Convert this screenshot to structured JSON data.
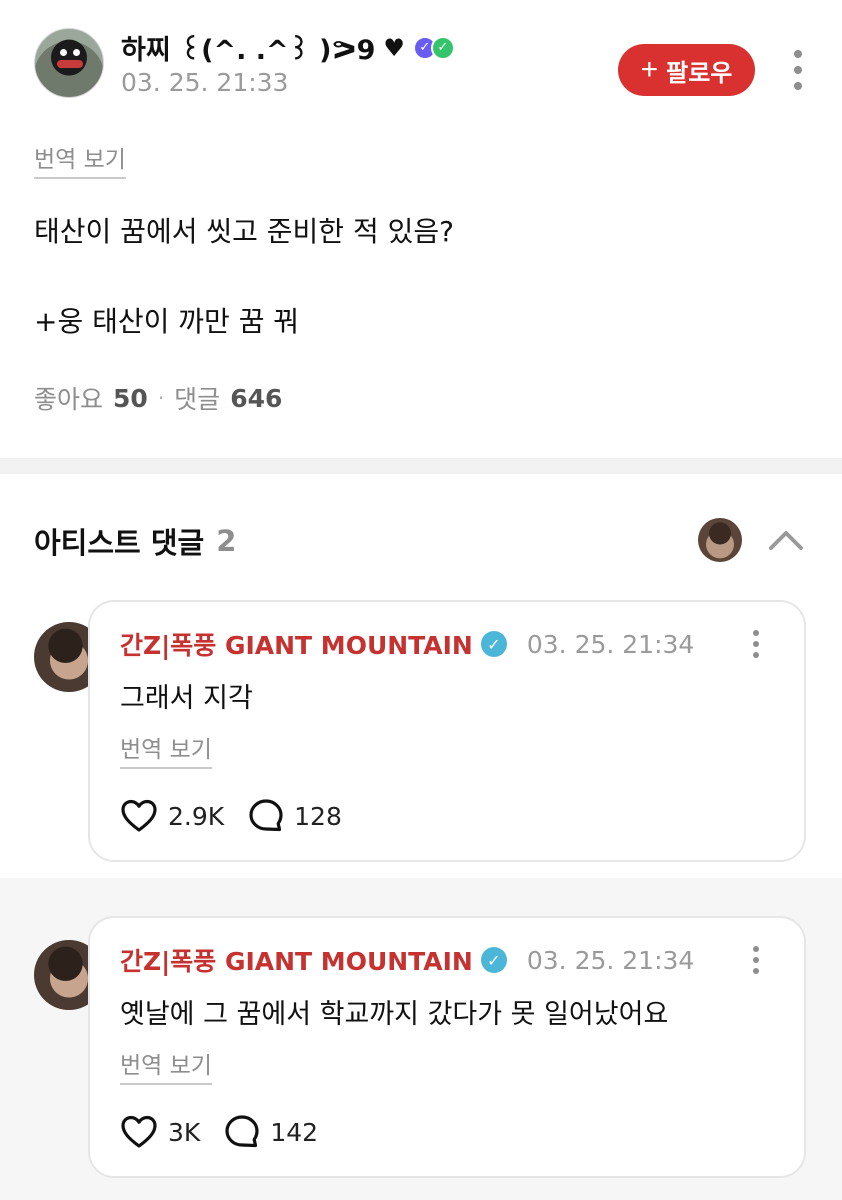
{
  "post": {
    "author": "하찌 ꒰(^. .^꒱ )ᕗ9",
    "heart": "♥",
    "badges": [
      "✓",
      "✓"
    ],
    "timestamp": "03. 25. 21:33",
    "follow_label": "팔로우",
    "follow_plus": "+",
    "translate_label": "번역 보기",
    "lines": [
      "태산이 꿈에서 씻고 준비한 적 있음?",
      "+웅 태산이 까만 꿈 꿔"
    ],
    "likes_label": "좋아요",
    "likes_count": "50",
    "separator": "·",
    "comments_label": "댓글",
    "comments_count": "646"
  },
  "artist_section": {
    "title": "아티스트 댓글",
    "count": "2"
  },
  "comments": [
    {
      "author": "간Z|폭풍 GIANT MOUNTAIN",
      "verified": "✓",
      "timestamp": "03. 25. 21:34",
      "text": "그래서 지각",
      "translate_label": "번역 보기",
      "likes": "2.9K",
      "replies": "128"
    },
    {
      "author": "간Z|폭풍 GIANT MOUNTAIN",
      "verified": "✓",
      "timestamp": "03. 25. 21:34",
      "text": "옛날에 그 꿈에서 학교까지 갔다가 못 일어났어요",
      "translate_label": "번역 보기",
      "likes": "3K",
      "replies": "142"
    }
  ],
  "colors": {
    "accent_red": "#d8312f",
    "author_red": "#c53230",
    "verified_blue": "#4cb6d8",
    "muted_gray": "#8e8e8e"
  },
  "icons": [
    "heart-icon",
    "comment-bubble-icon",
    "more-options-icon",
    "chevron-up-icon",
    "verified-icon"
  ]
}
